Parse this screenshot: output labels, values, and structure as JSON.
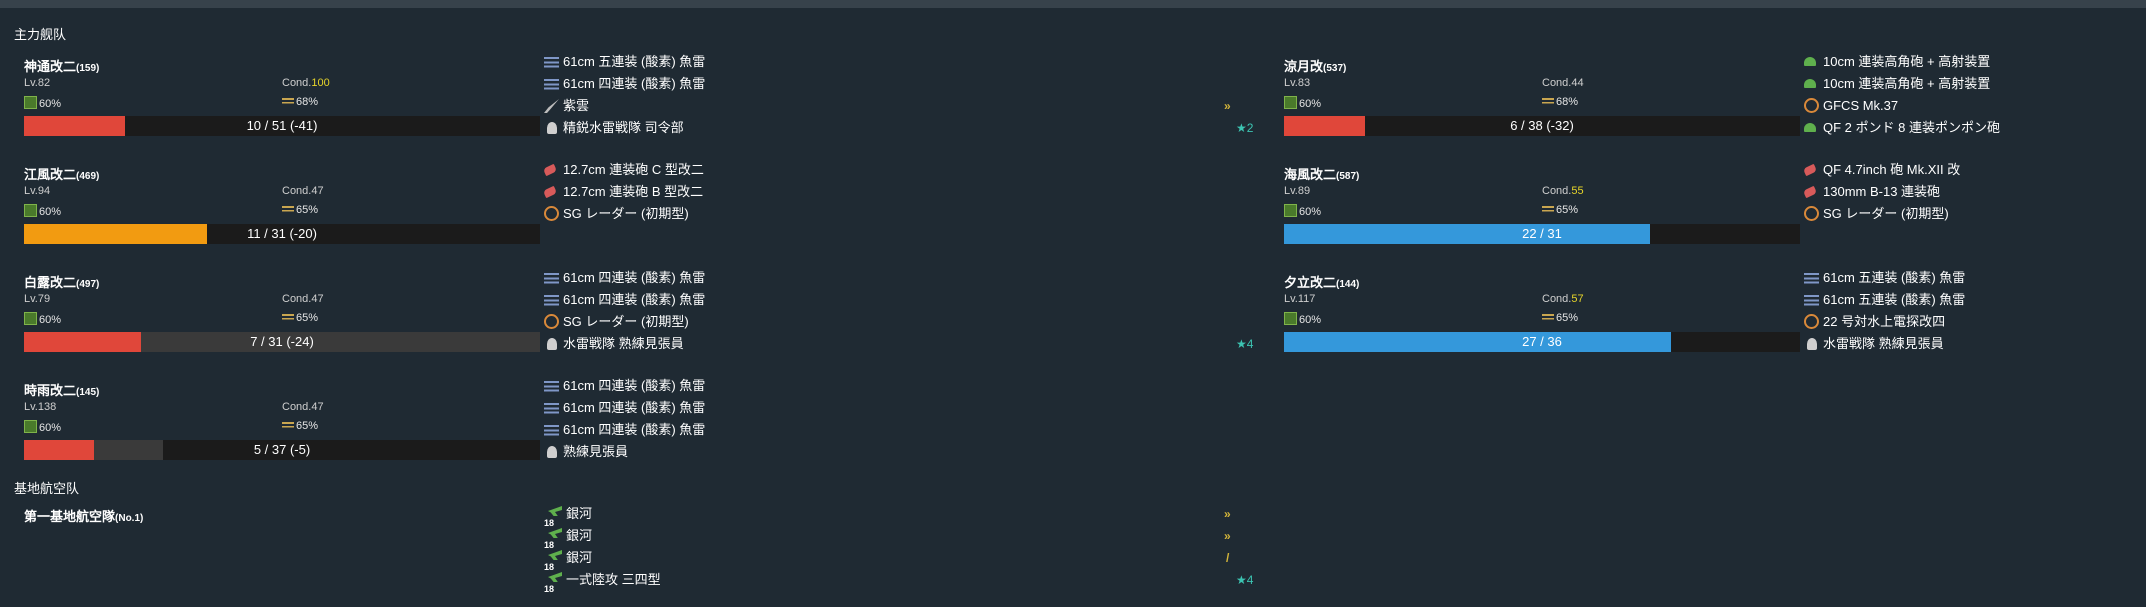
{
  "sections": {
    "main_fleet": "主力舰队",
    "lbas": "基地航空队"
  },
  "colors": {
    "hp_red": "#e0473a",
    "hp_orange": "#f29b11",
    "hp_blue": "#3498db",
    "cond_high": "#e6d42a",
    "star": "#3cc4b2"
  },
  "ships": [
    {
      "name": "神通改二",
      "id": "(159)",
      "lv": "Lv.82",
      "cond_label": "Cond.",
      "cond_value": "100",
      "fuel": "60%",
      "ammo": "68%",
      "hp_text": "10 / 51 (-41)",
      "hp_now": 10,
      "hp_max": 51,
      "hp_prev": 10,
      "equips": [
        {
          "icon": "torpedo-icon",
          "label": "61cm 五連装 (酸素) 魚雷"
        },
        {
          "icon": "torpedo-icon",
          "label": "61cm 四連装 (酸素) 魚雷"
        },
        {
          "icon": "seaplane-icon",
          "label": "紫雲",
          "extra": "»"
        },
        {
          "icon": "personnel-icon",
          "label": "精鋭水雷戦隊 司令部",
          "extra": "★2"
        }
      ]
    },
    {
      "name": "江風改二",
      "id": "(469)",
      "lv": "Lv.94",
      "cond_label": "Cond.",
      "cond_value": "47",
      "fuel": "60%",
      "ammo": "65%",
      "hp_text": "11 / 31 (-20)",
      "hp_now": 11,
      "hp_max": 31,
      "hp_prev": 11,
      "equips": [
        {
          "icon": "main-gun-icon",
          "label": "12.7cm 連装砲 C 型改二"
        },
        {
          "icon": "main-gun-icon",
          "label": "12.7cm 連装砲 B 型改二"
        },
        {
          "icon": "radar-icon",
          "label": "SG レーダー (初期型)"
        }
      ]
    },
    {
      "name": "白露改二",
      "id": "(497)",
      "lv": "Lv.79",
      "cond_label": "Cond.",
      "cond_value": "47",
      "fuel": "60%",
      "ammo": "65%",
      "hp_text": "7 / 31 (-24)",
      "hp_now": 7,
      "hp_max": 31,
      "hp_prev": 31,
      "equips": [
        {
          "icon": "torpedo-icon",
          "label": "61cm 四連装 (酸素) 魚雷"
        },
        {
          "icon": "torpedo-icon",
          "label": "61cm 四連装 (酸素) 魚雷"
        },
        {
          "icon": "radar-icon",
          "label": "SG レーダー (初期型)"
        },
        {
          "icon": "personnel-icon",
          "label": "水雷戦隊 熟練見張員",
          "extra": "★4"
        }
      ]
    },
    {
      "name": "時雨改二",
      "id": "(145)",
      "lv": "Lv.138",
      "cond_label": "Cond.",
      "cond_value": "47",
      "fuel": "60%",
      "ammo": "65%",
      "hp_text": "5 / 37 (-5)",
      "hp_now": 5,
      "hp_max": 37,
      "hp_prev": 10,
      "equips": [
        {
          "icon": "torpedo-icon",
          "label": "61cm 四連装 (酸素) 魚雷"
        },
        {
          "icon": "torpedo-icon",
          "label": "61cm 四連装 (酸素) 魚雷"
        },
        {
          "icon": "torpedo-icon",
          "label": "61cm 四連装 (酸素) 魚雷"
        },
        {
          "icon": "personnel-icon",
          "label": "熟練見張員"
        }
      ]
    },
    {
      "name": "涼月改",
      "id": "(537)",
      "lv": "Lv.83",
      "cond_label": "Cond.",
      "cond_value": "44",
      "fuel": "60%",
      "ammo": "68%",
      "hp_text": "6 / 38 (-32)",
      "hp_now": 6,
      "hp_max": 38,
      "hp_prev": 6,
      "equips": [
        {
          "icon": "aa-gun-icon",
          "label": "10cm 連装高角砲 + 高射装置"
        },
        {
          "icon": "aa-gun-icon",
          "label": "10cm 連装高角砲 + 高射装置"
        },
        {
          "icon": "radar-icon",
          "label": "GFCS Mk.37"
        },
        {
          "icon": "aa-gun-icon",
          "label": "QF 2 ポンド 8 連装ポンポン砲"
        }
      ]
    },
    {
      "name": "海風改二",
      "id": "(587)",
      "lv": "Lv.89",
      "cond_label": "Cond.",
      "cond_value": "55",
      "fuel": "60%",
      "ammo": "65%",
      "hp_text": "22 / 31",
      "hp_now": 22,
      "hp_max": 31,
      "hp_prev": 22,
      "equips": [
        {
          "icon": "main-gun-icon",
          "label": "QF 4.7inch 砲 Mk.XII 改"
        },
        {
          "icon": "main-gun-icon",
          "label": "130mm B-13 連装砲"
        },
        {
          "icon": "radar-icon",
          "label": "SG レーダー (初期型)"
        }
      ]
    },
    {
      "name": "夕立改二",
      "id": "(144)",
      "lv": "Lv.117",
      "cond_label": "Cond.",
      "cond_value": "57",
      "fuel": "60%",
      "ammo": "65%",
      "hp_text": "27 / 36",
      "hp_now": 27,
      "hp_max": 36,
      "hp_prev": 27,
      "equips": [
        {
          "icon": "torpedo-icon",
          "label": "61cm 五連装 (酸素) 魚雷"
        },
        {
          "icon": "torpedo-icon",
          "label": "61cm 五連装 (酸素) 魚雷"
        },
        {
          "icon": "radar-icon",
          "label": "22 号対水上電探改四"
        },
        {
          "icon": "personnel-icon",
          "label": "水雷戦隊 熟練見張員"
        }
      ]
    }
  ],
  "lbas": {
    "name": "第一基地航空隊",
    "no": "(No.1)",
    "squadrons": [
      {
        "count": "18",
        "label": "銀河",
        "extra": "»"
      },
      {
        "count": "18",
        "label": "銀河",
        "extra": "»"
      },
      {
        "count": "18",
        "label": "銀河",
        "extra": "/"
      },
      {
        "count": "18",
        "label": "一式陸攻 三四型",
        "extra": "★4"
      }
    ]
  }
}
